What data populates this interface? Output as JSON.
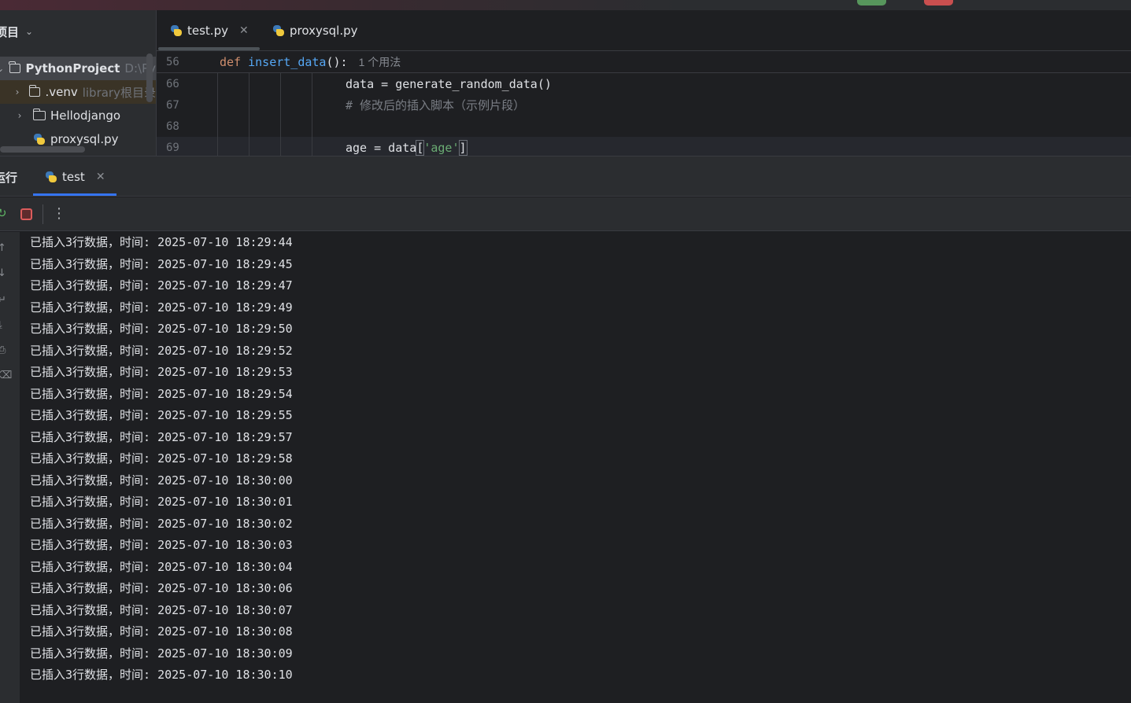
{
  "project_panel": {
    "title": "项目",
    "items": [
      {
        "name": "PythonProject",
        "hint": "D:\\Py",
        "expanded": true
      },
      {
        "name": ".venv",
        "hint": "library根目录",
        "expanded": false
      },
      {
        "name": "Hellodjango",
        "hint": "",
        "expanded": false
      },
      {
        "name": "proxysql.py",
        "hint": ""
      }
    ]
  },
  "editor": {
    "tabs": [
      {
        "label": "test.py",
        "active": true
      },
      {
        "label": "proxysql.py",
        "active": false
      }
    ],
    "sticky_line": {
      "num": "56",
      "def": "def",
      "fn": "insert_data",
      "rest": "():",
      "hint": "1 个用法"
    },
    "lines": [
      {
        "num": "66",
        "text": "data = generate_random_data()"
      },
      {
        "num": "67",
        "text": "# 修改后的插入脚本（示例片段）"
      },
      {
        "num": "68",
        "text": ""
      },
      {
        "num": "69",
        "pre": "age = data",
        "str": "'age'"
      }
    ]
  },
  "run_panel": {
    "title": "运行",
    "tab": "test",
    "output": [
      "已插入3行数据，时间: 2025-07-10 18:29:44",
      "已插入3行数据，时间: 2025-07-10 18:29:45",
      "已插入3行数据，时间: 2025-07-10 18:29:47",
      "已插入3行数据，时间: 2025-07-10 18:29:49",
      "已插入3行数据，时间: 2025-07-10 18:29:50",
      "已插入3行数据，时间: 2025-07-10 18:29:52",
      "已插入3行数据，时间: 2025-07-10 18:29:53",
      "已插入3行数据，时间: 2025-07-10 18:29:54",
      "已插入3行数据，时间: 2025-07-10 18:29:55",
      "已插入3行数据，时间: 2025-07-10 18:29:57",
      "已插入3行数据，时间: 2025-07-10 18:29:58",
      "已插入3行数据，时间: 2025-07-10 18:30:00",
      "已插入3行数据，时间: 2025-07-10 18:30:01",
      "已插入3行数据，时间: 2025-07-10 18:30:02",
      "已插入3行数据，时间: 2025-07-10 18:30:03",
      "已插入3行数据，时间: 2025-07-10 18:30:04",
      "已插入3行数据，时间: 2025-07-10 18:30:06",
      "已插入3行数据，时间: 2025-07-10 18:30:07",
      "已插入3行数据，时间: 2025-07-10 18:30:08",
      "已插入3行数据，时间: 2025-07-10 18:30:09",
      "已插入3行数据，时间: 2025-07-10 18:30:10"
    ]
  },
  "colors": {
    "background": "#1e1f22",
    "panel": "#2b2d30",
    "keyword": "#cf8e6d",
    "function": "#56a8f5",
    "string": "#6aab73",
    "accent": "#3574f0",
    "stop": "#db5c5c"
  },
  "icons": {
    "project_chevron": "chevron-down-icon",
    "folder": "folder-icon",
    "python_file": "python-file-icon",
    "stop": "stop-icon",
    "more": "more-vertical-icon",
    "rerun": "rerun-icon",
    "close": "close-icon"
  }
}
